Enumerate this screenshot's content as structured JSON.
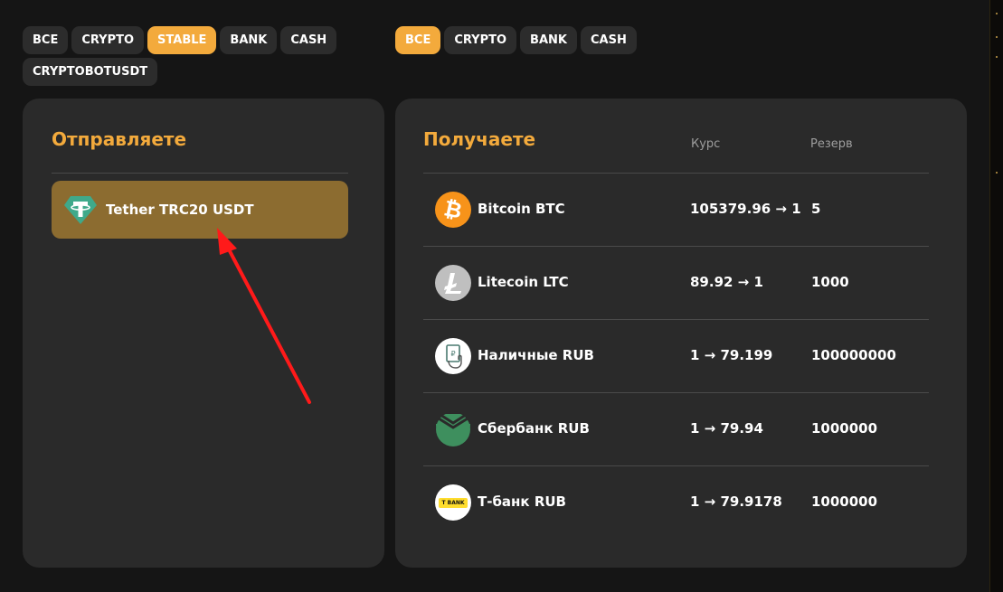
{
  "send_filters": [
    {
      "label": "ВСЕ",
      "active": false
    },
    {
      "label": "CRYPTO",
      "active": false
    },
    {
      "label": "STABLE",
      "active": true
    },
    {
      "label": "BANK",
      "active": false
    },
    {
      "label": "CASH",
      "active": false
    },
    {
      "label": "CRYPTOBOTUSDT",
      "active": false
    }
  ],
  "receive_filters": [
    {
      "label": "ВСЕ",
      "active": true
    },
    {
      "label": "CRYPTO",
      "active": false
    },
    {
      "label": "BANK",
      "active": false
    },
    {
      "label": "CASH",
      "active": false
    }
  ],
  "send": {
    "title": "Отправляете",
    "selected_item": {
      "label": "Tether TRC20 USDT",
      "icon": "tether-icon"
    }
  },
  "receive": {
    "title": "Получаете",
    "col_rate": "Курс",
    "col_reserve": "Резерв",
    "rows": [
      {
        "name": "Bitcoin BTC",
        "rate": "105379.96 → 1",
        "reserve": "5",
        "icon": "bitcoin-icon"
      },
      {
        "name": "Litecoin LTC",
        "rate": "89.92 → 1",
        "reserve": "1000",
        "icon": "litecoin-icon"
      },
      {
        "name": "Наличные RUB",
        "rate": "1 → 79.199",
        "reserve": "100000000",
        "icon": "cash-icon"
      },
      {
        "name": "Сбербанк RUB",
        "rate": "1 → 79.94",
        "reserve": "1000000",
        "icon": "sberbank-icon"
      },
      {
        "name": "Т-банк RUB",
        "rate": "1 → 79.9178",
        "reserve": "1000000",
        "icon": "tbank-icon",
        "icon_text": "T BANK"
      }
    ]
  },
  "colors": {
    "accent": "#f3aa3c",
    "selected_item": "#8c6c30",
    "panel": "#2a2a2a",
    "background": "#151515",
    "annotation_arrow": "#ff1a1a"
  }
}
